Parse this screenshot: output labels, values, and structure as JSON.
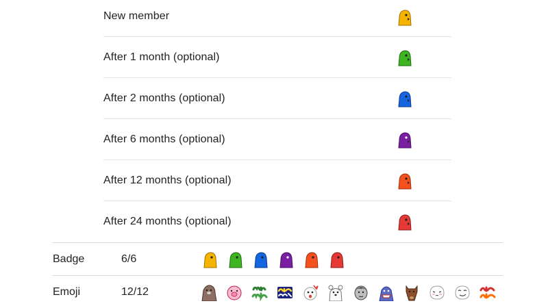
{
  "tiers": [
    {
      "label": "New member",
      "badge_icon": "bird-badge-yellow-icon",
      "color": "#f4b400"
    },
    {
      "label": "After 1 month (optional)",
      "badge_icon": "bird-badge-green-icon",
      "color": "#3cb521"
    },
    {
      "label": "After 2 months (optional)",
      "badge_icon": "bird-badge-blue-icon",
      "color": "#1565e0"
    },
    {
      "label": "After 6 months (optional)",
      "badge_icon": "bird-badge-purple-icon",
      "color": "#7b1fa2"
    },
    {
      "label": "After 12 months (optional)",
      "badge_icon": "bird-badge-orange-icon",
      "color": "#f4511e"
    },
    {
      "label": "After 24 months (optional)",
      "badge_icon": "bird-badge-red-icon",
      "color": "#e53935"
    }
  ],
  "summary": {
    "badge": {
      "label": "Badge",
      "count": "6/6"
    },
    "emoji": {
      "label": "Emoji",
      "count": "12/12",
      "icons": [
        "otter-emoji-icon",
        "pig-emoji-icon",
        "green-thai-text-emoji-icon",
        "blue-yellow-thai-text-emoji-icon",
        "shocked-face-emoji-icon",
        "polar-bear-emoji-icon",
        "man-face-emoji-icon",
        "shark-emoji-icon",
        "horse-emoji-icon",
        "blushing-face-emoji-icon",
        "smirk-face-emoji-icon",
        "red-thai-text-emoji-icon"
      ]
    }
  }
}
